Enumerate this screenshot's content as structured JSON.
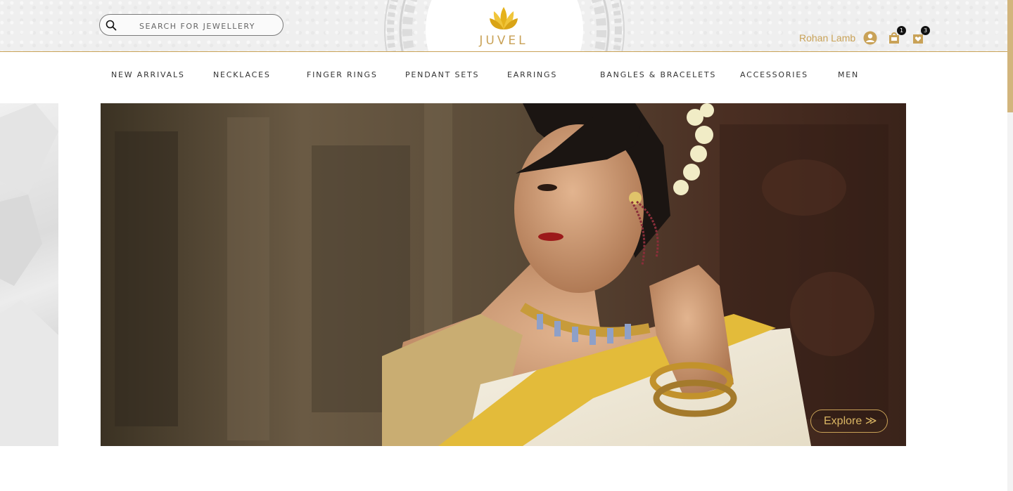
{
  "header": {
    "search": {
      "placeholder": "SEARCH FOR JEWELLERY"
    },
    "logo_text": "JUVEL",
    "user_name": "Rohan Lamb",
    "cart_count": "1",
    "wishlist_count": "3",
    "accent_color": "#c9a257"
  },
  "nav": {
    "items": [
      {
        "label": "NEW ARRIVALS"
      },
      {
        "label": "NECKLACES"
      },
      {
        "label": "FINGER RINGS"
      },
      {
        "label": "PENDANT SETS"
      },
      {
        "label": "EARRINGS"
      },
      {
        "label": "BANGLES & BRACELETS"
      },
      {
        "label": "ACCESSORIES"
      },
      {
        "label": "MEN"
      }
    ]
  },
  "hero": {
    "cta_label": "Explore ≫",
    "image_icon": "model-wearing-jewellery-image"
  }
}
